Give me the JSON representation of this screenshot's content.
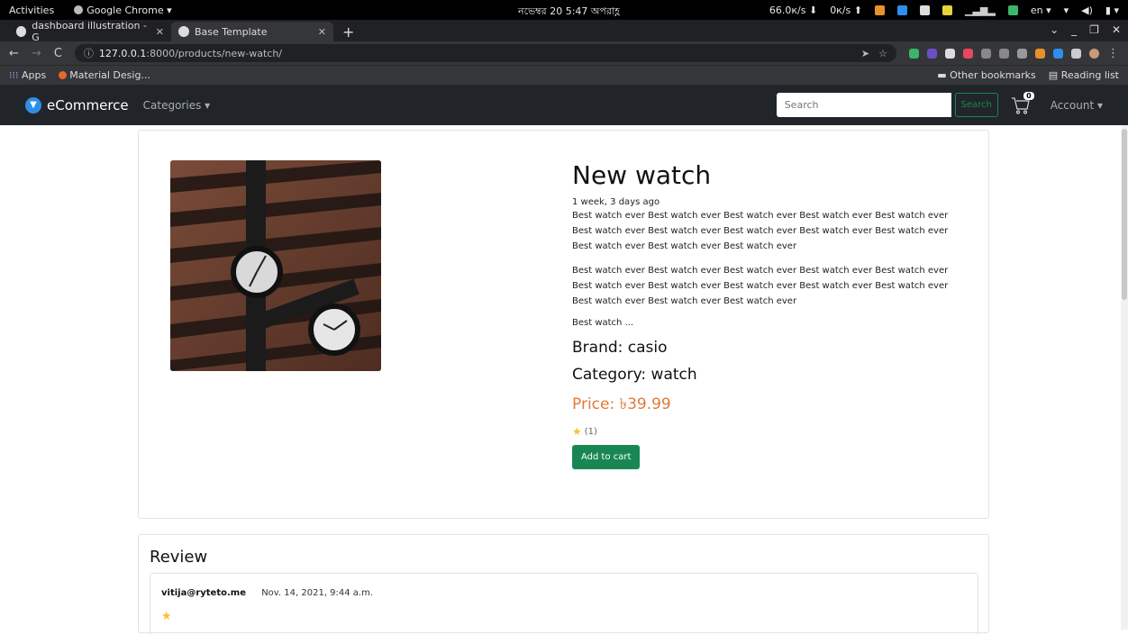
{
  "system_bar": {
    "activities": "Activities",
    "app": "Google Chrome",
    "clock": "নভেম্বর 20  5:47 অপরাহ্ণ",
    "net_down": "66.0к/s",
    "net_up": "0к/s",
    "lang": "en"
  },
  "browser": {
    "tabs": [
      {
        "label": "dashboard illustration - G"
      },
      {
        "label": "Base Template"
      }
    ],
    "url_host": "127.0.0.1",
    "url_path": ":8000/products/new-watch/",
    "bookmarks": {
      "apps": "Apps",
      "material": "Material Desig...",
      "other": "Other bookmarks",
      "reading": "Reading list"
    }
  },
  "navbar": {
    "brand": "eCommerce",
    "categories": "Categories",
    "search_placeholder": "Search",
    "search_button": "Search",
    "cart_count": "0",
    "account": "Account"
  },
  "product": {
    "title": "New watch",
    "posted": "1 week, 3 days ago",
    "paragraph1": "Best watch ever Best watch ever Best watch ever Best watch ever Best watch ever Best watch ever Best watch ever Best watch ever Best watch ever Best watch ever Best watch ever Best watch ever Best watch ever",
    "paragraph2": "Best watch ever Best watch ever Best watch ever Best watch ever Best watch ever Best watch ever Best watch ever Best watch ever Best watch ever Best watch ever Best watch ever Best watch ever Best watch ever",
    "short": "Best watch ...",
    "brand": "Brand: casio",
    "category": "Category: watch",
    "price": "Price: ৳39.99",
    "rating_count": "(1)",
    "add_to_cart": "Add to cart"
  },
  "review": {
    "heading": "Review",
    "items": [
      {
        "user": "vitija@ryteto.me",
        "date": "Nov. 14, 2021, 9:44 a.m."
      }
    ]
  },
  "colors": {
    "navbar": "#212529",
    "success": "#198754",
    "price": "#e07a3a",
    "star": "#f6c337"
  }
}
